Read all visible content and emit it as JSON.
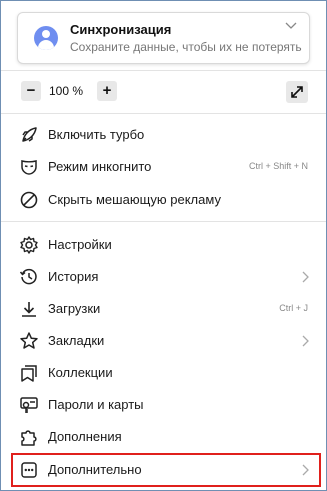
{
  "sync": {
    "title": "Синхронизация",
    "subtitle": "Сохраните данные, чтобы их не потерять"
  },
  "zoom": {
    "minus_label": "−",
    "value": "100 %",
    "plus_label": "+"
  },
  "menu": {
    "turbo": {
      "label": "Включить турбо",
      "icon": "rocket-icon"
    },
    "incognito": {
      "label": "Режим инкогнито",
      "shortcut": "Ctrl + Shift + N",
      "icon": "incognito-mask-icon"
    },
    "hide_ads": {
      "label": "Скрыть мешающую рекламу",
      "icon": "block-icon"
    },
    "settings": {
      "label": "Настройки",
      "icon": "gear-icon"
    },
    "history": {
      "label": "История",
      "icon": "history-icon"
    },
    "downloads": {
      "label": "Загрузки",
      "shortcut": "Ctrl + J",
      "icon": "download-icon"
    },
    "bookmarks": {
      "label": "Закладки",
      "icon": "star-icon"
    },
    "collections": {
      "label": "Коллекции",
      "icon": "collections-icon"
    },
    "passwords": {
      "label": "Пароли и карты",
      "icon": "key-card-icon"
    },
    "extensions": {
      "label": "Дополнения",
      "icon": "puzzle-icon"
    },
    "more": {
      "label": "Дополнительно",
      "icon": "more-dots-icon"
    }
  },
  "colors": {
    "highlight_border": "#e0201c",
    "avatar": "#6f8ef0"
  }
}
